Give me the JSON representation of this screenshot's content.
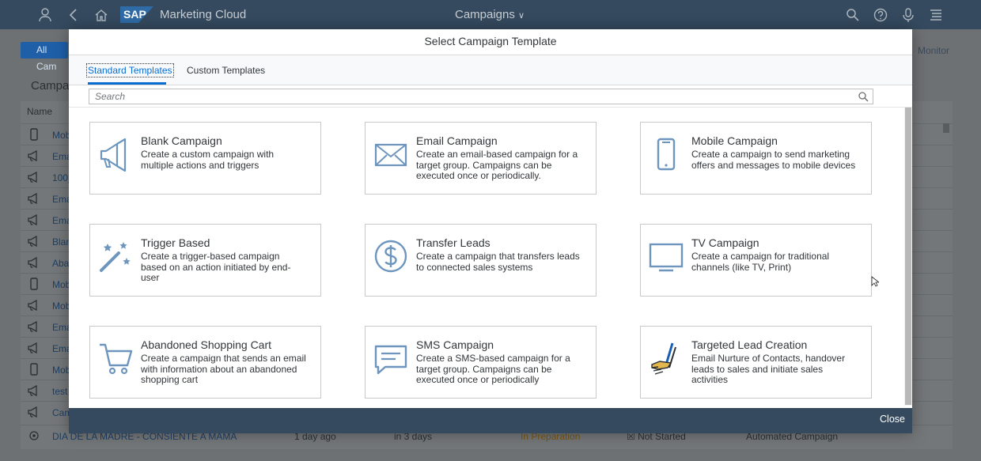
{
  "shell": {
    "logo_text": "SAP",
    "app_title": "Marketing Cloud",
    "center_title": "Campaigns"
  },
  "background": {
    "all_button": "All Cam",
    "monitor_label": "Monitor",
    "section_title": "Campai",
    "name_header": "Name",
    "rows": [
      {
        "icon": "mobile-icon",
        "name": "Mobil"
      },
      {
        "icon": "megaphone-icon",
        "name": "Ema"
      },
      {
        "icon": "megaphone-icon",
        "name": "100_"
      },
      {
        "icon": "megaphone-icon",
        "name": "Ema"
      },
      {
        "icon": "megaphone-icon",
        "name": "Ema"
      },
      {
        "icon": "megaphone-icon",
        "name": "Blan"
      },
      {
        "icon": "megaphone-icon",
        "name": "Aban"
      },
      {
        "icon": "mobile-icon",
        "name": "Mobil"
      },
      {
        "icon": "megaphone-icon",
        "name": "Mob"
      },
      {
        "icon": "megaphone-icon",
        "name": "Ema"
      },
      {
        "icon": "megaphone-icon",
        "name": "Ema"
      },
      {
        "icon": "mobile-icon",
        "name": "Mobil"
      },
      {
        "icon": "megaphone-icon",
        "name": "test"
      },
      {
        "icon": "megaphone-icon",
        "name": "Cam"
      }
    ],
    "last_row": {
      "name": "DIA DE LA MADRE - CONSIENTE A MAMA",
      "created": "1 day ago",
      "start": "in 3 days",
      "status": "In Preparation",
      "execution": "Not Started",
      "type": "Automated Campaign"
    }
  },
  "dialog": {
    "title": "Select Campaign Template",
    "tabs": [
      {
        "label": "Standard Templates",
        "active": true
      },
      {
        "label": "Custom Templates",
        "active": false
      }
    ],
    "search_placeholder": "Search",
    "tiles": [
      {
        "icon": "megaphone-icon",
        "title": "Blank Campaign",
        "desc": "Create a custom campaign with multiple actions and triggers"
      },
      {
        "icon": "email-icon",
        "title": "Email Campaign",
        "desc": "Create an email-based campaign for a target group. Campaigns can be executed once or periodically."
      },
      {
        "icon": "mobile-icon",
        "title": "Mobile Campaign",
        "desc": "Create a campaign to send marketing offers and messages to mobile devices"
      },
      {
        "icon": "magic-wand-icon",
        "title": "Trigger Based",
        "desc": "Create a trigger-based campaign based on an action initiated by end-user"
      },
      {
        "icon": "dollar-icon",
        "title": "Transfer Leads",
        "desc": "Create a campaign that transfers leads to connected sales systems"
      },
      {
        "icon": "tv-icon",
        "title": "TV Campaign",
        "desc": "Create a campaign for traditional channels (like TV, Print)"
      },
      {
        "icon": "cart-icon",
        "title": "Abandoned Shopping Cart",
        "desc": "Create a campaign that sends an email with information about an abandoned shopping cart"
      },
      {
        "icon": "sms-icon",
        "title": "SMS Campaign",
        "desc": "Create a SMS-based campaign for a target group. Campaigns can be executed once or periodically"
      },
      {
        "icon": "lead-creation-icon",
        "title": "Targeted Lead Creation",
        "desc": "Email Nurture of Contacts, handover leads to sales and initiate sales activities"
      }
    ],
    "close_label": "Close"
  },
  "colors": {
    "shell": "#354a5f",
    "accent": "#0a6ed1",
    "icon": "#6e95bd"
  }
}
